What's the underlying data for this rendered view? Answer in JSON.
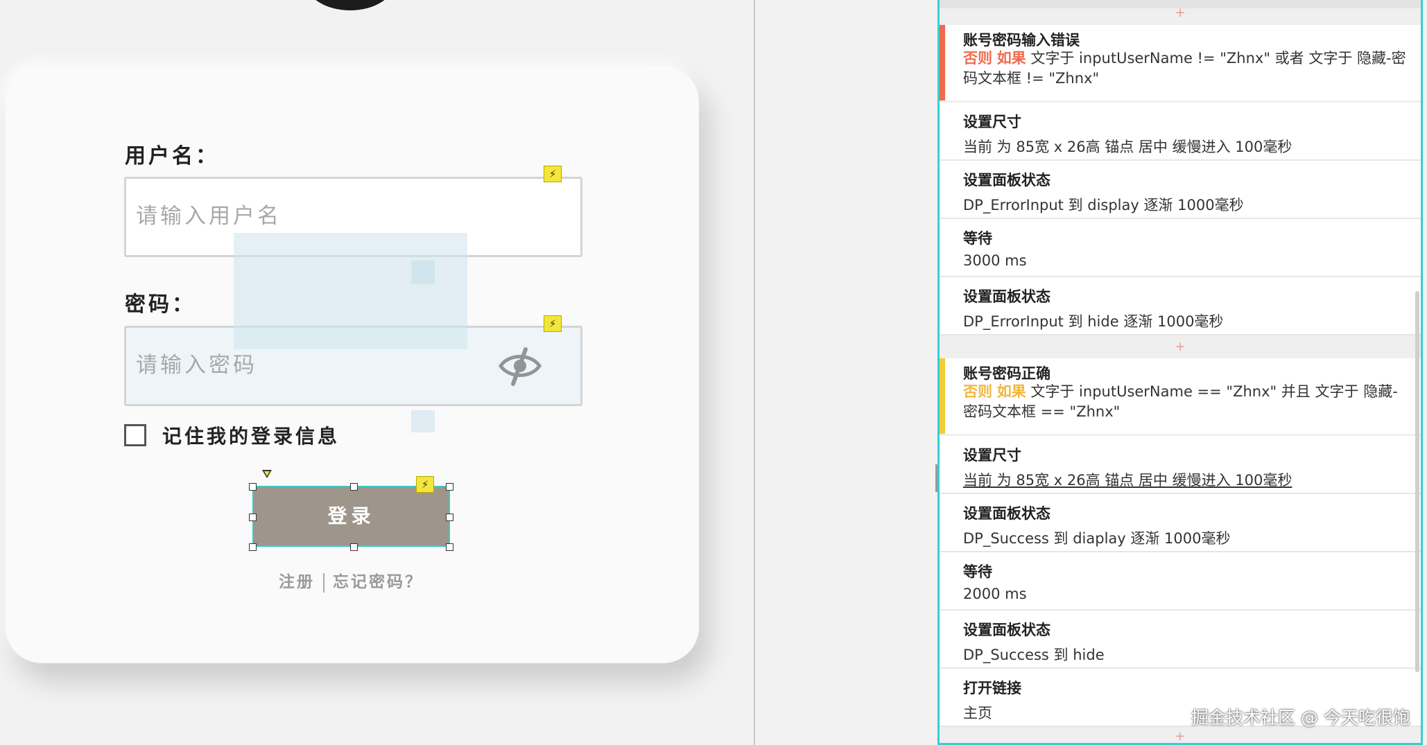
{
  "login": {
    "username_label": "用户名：",
    "username_placeholder": "请输入用户名",
    "password_label": "密码：",
    "password_placeholder": "请输入密码",
    "remember_label": "记住我的登录信息",
    "login_button": "登录",
    "register_link": "注册",
    "forgot_link": "忘记密码？"
  },
  "icons": {
    "bolt": "⚡",
    "eye": "eye-slash-icon"
  },
  "interactions": {
    "plus": "+",
    "case_error": {
      "title": "账号密码输入错误",
      "else": "否则",
      "if": "如果",
      "condition": "文字于 inputUserName != \"Zhnx\" 或者 文字于 隐藏-密码文本框 != \"Zhnx\"",
      "accent_color": "#ef6a4d",
      "keyword_color": "#ef6a4d",
      "actions": [
        {
          "title": "设置尺寸",
          "desc": "当前 为 85宽 x 26高  锚点 居中 缓慢进入 100毫秒"
        },
        {
          "title": "设置面板状态",
          "desc": "DP_ErrorInput 到 display 逐渐 1000毫秒"
        },
        {
          "title": "等待",
          "desc": "3000 ms"
        },
        {
          "title": "设置面板状态",
          "desc": "DP_ErrorInput 到 hide 逐渐 1000毫秒"
        }
      ]
    },
    "case_success": {
      "title": "账号密码正确",
      "else": "否则",
      "if": "如果",
      "condition": "文字于 inputUserName == \"Zhnx\" 并且 文字于 隐藏-密码文本框 == \"Zhnx\"",
      "accent_color": "#f2cd3a",
      "keyword_color": "#f2b63a",
      "actions": [
        {
          "title": "设置尺寸",
          "desc": "当前 为 85宽 x 26高  锚点 居中 缓慢进入 100毫秒"
        },
        {
          "title": "设置面板状态",
          "desc": "DP_Success 到 diaplay 逐渐 1000毫秒"
        },
        {
          "title": "等待",
          "desc": "2000 ms"
        },
        {
          "title": "设置面板状态",
          "desc": "DP_Success 到 hide"
        },
        {
          "title": "打开链接",
          "desc": "主页"
        }
      ]
    }
  },
  "watermark": "掘金技术社区 @ 今天吃很饱",
  "colors": {
    "button_bg": "#9e968b",
    "selection_border": "#3fc6c6",
    "panel_border": "#35d0d2"
  }
}
